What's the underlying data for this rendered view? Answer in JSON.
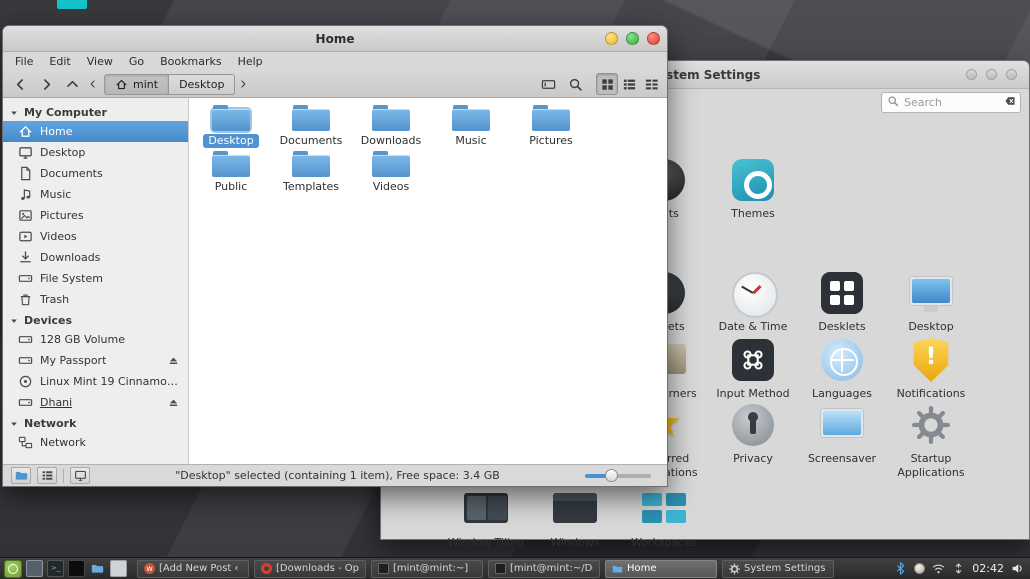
{
  "file_manager": {
    "title": "Home",
    "menu_items": [
      "File",
      "Edit",
      "View",
      "Go",
      "Bookmarks",
      "Help"
    ],
    "breadcrumbs": {
      "home": "mint",
      "current": "Desktop"
    },
    "toolbar_icons": [
      "back",
      "forward",
      "up",
      "scroll-left",
      "scroll-right",
      "edit-location",
      "search",
      "grid-view",
      "list-view",
      "compact-view"
    ],
    "sidebar": {
      "sections": [
        {
          "label": "My Computer",
          "items": [
            {
              "label": "Home",
              "icon": "home",
              "selected": true
            },
            {
              "label": "Desktop",
              "icon": "desktop"
            },
            {
              "label": "Documents",
              "icon": "documents"
            },
            {
              "label": "Music",
              "icon": "music"
            },
            {
              "label": "Pictures",
              "icon": "pictures"
            },
            {
              "label": "Videos",
              "icon": "videos"
            },
            {
              "label": "Downloads",
              "icon": "downloads"
            },
            {
              "label": "File System",
              "icon": "drive"
            },
            {
              "label": "Trash",
              "icon": "trash"
            }
          ]
        },
        {
          "label": "Devices",
          "items": [
            {
              "label": "128 GB Volume",
              "icon": "drive"
            },
            {
              "label": "My Passport",
              "icon": "drive",
              "eject": true
            },
            {
              "label": "Linux Mint 19 Cinnamon ...",
              "icon": "disc"
            },
            {
              "label": "Dhani",
              "icon": "drive",
              "eject": true
            }
          ]
        },
        {
          "label": "Network",
          "items": [
            {
              "label": "Network",
              "icon": "network"
            }
          ]
        }
      ]
    },
    "files": [
      {
        "label": "Desktop",
        "selected": true
      },
      {
        "label": "Documents"
      },
      {
        "label": "Downloads"
      },
      {
        "label": "Music"
      },
      {
        "label": "Pictures"
      },
      {
        "label": "Public"
      },
      {
        "label": "Templates"
      },
      {
        "label": "Videos"
      }
    ],
    "statusbar": {
      "text": "\"Desktop\" selected (containing 1 item), Free space: 3.4 GB",
      "icons": [
        "places-toggle",
        "treeview-toggle",
        "sidebar-toggle",
        "zoom-slider"
      ]
    }
  },
  "system_settings": {
    "title": "System Settings",
    "search_placeholder": "Search",
    "items": [
      {
        "label": "Fonts",
        "partially_visible": true
      },
      {
        "label": "Themes"
      },
      {
        "label": "Applets",
        "partially_visible": true
      },
      {
        "label": "Date & Time"
      },
      {
        "label": "Desklets"
      },
      {
        "label": "Desktop"
      },
      {
        "label": "Hot Corners",
        "partially_visible": true
      },
      {
        "label": "Input Method"
      },
      {
        "label": "Languages"
      },
      {
        "label": "Notifications"
      },
      {
        "label": "Preferred Applications",
        "partially_visible": true
      },
      {
        "label": "Privacy"
      },
      {
        "label": "Screensaver"
      },
      {
        "label": "Startup Applications"
      },
      {
        "label": "Window Tiling"
      },
      {
        "label": "Windows"
      },
      {
        "label": "Workspaces"
      }
    ]
  },
  "taskbar": {
    "launchers": [
      "mint-menu",
      "show-desktop",
      "terminal",
      "terminal-dark",
      "files",
      "screenshot"
    ],
    "window_buttons": [
      {
        "label": "[Add New Post ‹ Ma...",
        "icon": "wordpress"
      },
      {
        "label": "[Downloads - Opera]",
        "icon": "opera"
      },
      {
        "label": "[mint@mint:~]",
        "icon": "terminal"
      },
      {
        "label": "[mint@mint:~/Dow...",
        "icon": "terminal"
      },
      {
        "label": "Home",
        "icon": "folder",
        "active": true
      },
      {
        "label": "System Settings",
        "icon": "gear"
      }
    ],
    "tray_icons": [
      "bluetooth",
      "applet-circle",
      "wifi",
      "sync"
    ],
    "clock": "02:42",
    "volume_icon": "volume"
  }
}
